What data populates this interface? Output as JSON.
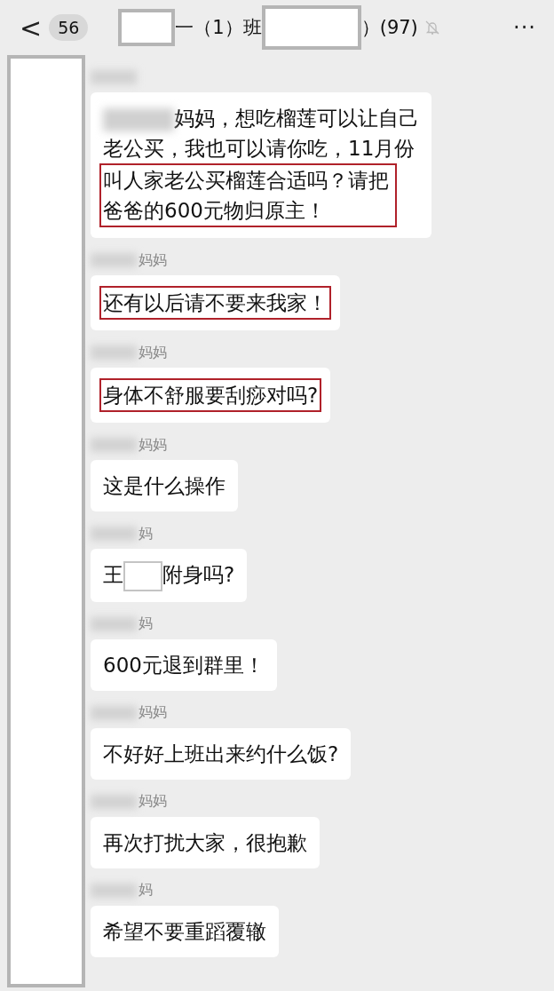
{
  "header": {
    "back_icon": "<",
    "unread": "56",
    "title_parts": [
      {
        "kind": "redacted"
      },
      {
        "kind": "text",
        "text": "一（1）班"
      },
      {
        "kind": "redacted"
      },
      {
        "kind": "text",
        "text": "）(97)"
      }
    ],
    "muted": true,
    "more": "···"
  },
  "messages": [
    {
      "parts": [
        {
          "kind": "blurred"
        },
        {
          "kind": "text",
          "text": "妈妈，想吃榴莲可以让自己",
          "highlighted": false
        },
        {
          "kind": "text",
          "text": "老公买，我也可以请你吃，11月份",
          "highlighted": false
        },
        {
          "kind": "text",
          "text": "叫人家老公买榴莲合适吗？请把爸爸的600元物归原主！",
          "highlighted": true
        }
      ]
    },
    {
      "sender": "妈妈",
      "parts": [
        {
          "kind": "text",
          "text": "还有以后请不要来我家！",
          "highlighted": true
        }
      ]
    },
    {
      "sender": "妈妈",
      "parts": [
        {
          "kind": "text",
          "text": "身体不舒服要刮痧对吗?",
          "highlighted": true
        }
      ]
    },
    {
      "sender": "妈妈",
      "parts": [
        {
          "kind": "text",
          "text": "这是什么操作",
          "highlighted": false
        }
      ]
    },
    {
      "sender": "妈",
      "parts": [
        {
          "kind": "text",
          "text": "王",
          "highlighted": false
        },
        {
          "kind": "redacted"
        },
        {
          "kind": "text",
          "text": "附身吗?",
          "highlighted": false
        }
      ]
    },
    {
      "sender": "妈",
      "parts": [
        {
          "kind": "text",
          "text": "600元退到群里！",
          "highlighted": false
        }
      ]
    },
    {
      "sender": "妈妈",
      "parts": [
        {
          "kind": "text",
          "text": "不好好上班出来约什么饭?",
          "highlighted": false
        }
      ]
    },
    {
      "sender": "妈妈",
      "parts": [
        {
          "kind": "text",
          "text": "再次打扰大家，很抱歉",
          "highlighted": false
        }
      ]
    },
    {
      "sender": "妈",
      "parts": [
        {
          "kind": "text",
          "text": "希望不要重蹈覆辙",
          "highlighted": false
        }
      ]
    }
  ]
}
